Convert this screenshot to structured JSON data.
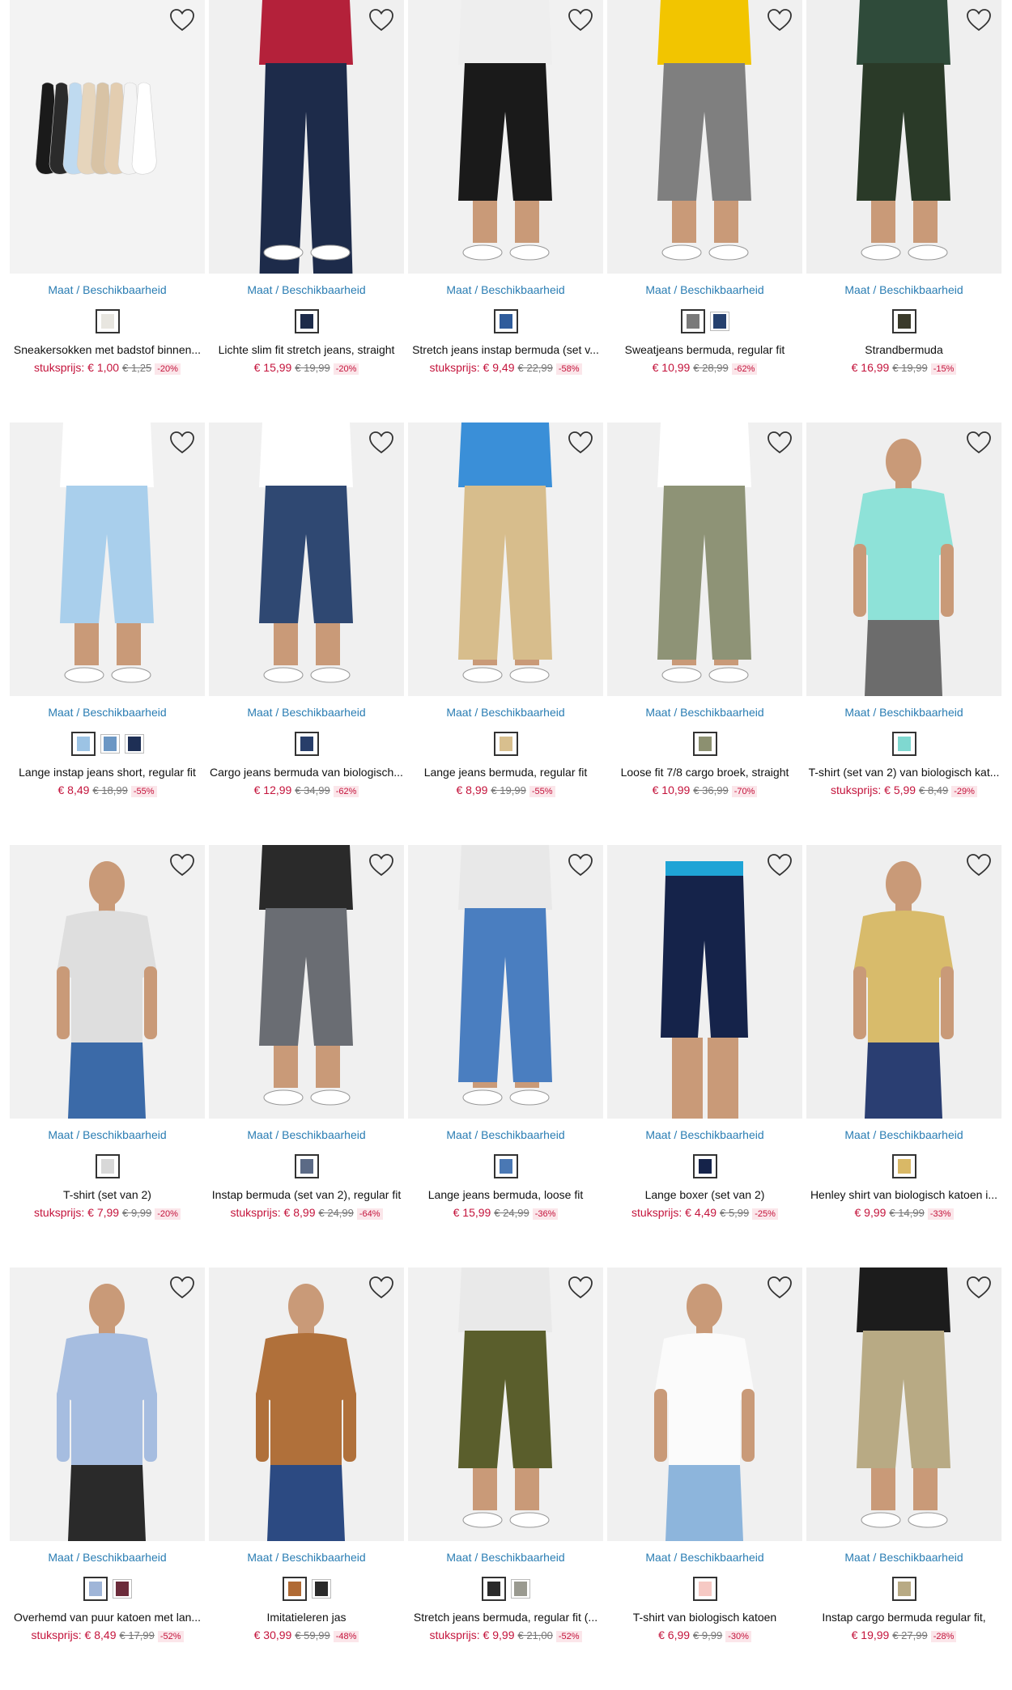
{
  "ui": {
    "size_link": "Maat / Beschikbaarheid"
  },
  "products": [
    {
      "name": "Sneakersokken met badstof binnen...",
      "price": "stuksprijs: € 1,00",
      "old": "€ 1,25",
      "discount": "-20%",
      "bg": "#f3f3f3",
      "swatches": [
        "#e8e6e0"
      ]
    },
    {
      "name": "Lichte slim fit stretch jeans, straight",
      "price": "€ 15,99",
      "old": "€ 19,99",
      "discount": "-20%",
      "bg": "#f0f0f0",
      "swatches": [
        "#1d2b4a"
      ]
    },
    {
      "name": "Stretch jeans instap bermuda (set v...",
      "price": "stuksprijs: € 9,49",
      "old": "€ 22,99",
      "discount": "-58%",
      "bg": "#f1f1f1",
      "swatches": [
        "#2f5c9c"
      ]
    },
    {
      "name": "Sweatjeans bermuda, regular fit",
      "price": "€ 10,99",
      "old": "€ 28,99",
      "discount": "-62%",
      "bg": "#f0f0f0",
      "swatches": [
        "#7a7a7a",
        "#25406e"
      ]
    },
    {
      "name": "Strandbermuda",
      "price": "€ 16,99",
      "old": "€ 19,99",
      "discount": "-15%",
      "bg": "#efefef",
      "swatches": [
        "#3a3a2a"
      ]
    },
    {
      "name": "Lange instap jeans short, regular fit",
      "price": "€ 8,49",
      "old": "€ 18,99",
      "discount": "-55%",
      "bg": "#f1f1f1",
      "swatches": [
        "#9cc3e4",
        "#6c97c4",
        "#1e2f55"
      ]
    },
    {
      "name": "Cargo jeans bermuda van biologisch...",
      "price": "€ 12,99",
      "old": "€ 34,99",
      "discount": "-62%",
      "bg": "#f0f0f0",
      "swatches": [
        "#283e6a"
      ]
    },
    {
      "name": "Lange jeans bermuda, regular fit",
      "price": "€ 8,99",
      "old": "€ 19,99",
      "discount": "-55%",
      "bg": "#f1f1f1",
      "swatches": [
        "#d8bf8e"
      ]
    },
    {
      "name": "Loose fit 7/8 cargo broek, straight",
      "price": "€ 10,99",
      "old": "€ 36,99",
      "discount": "-70%",
      "bg": "#f0f0f0",
      "swatches": [
        "#8c9070"
      ]
    },
    {
      "name": "T-shirt (set van 2) van biologisch kat...",
      "price": "stuksprijs: € 5,99",
      "old": "€ 8,49",
      "discount": "-29%",
      "bg": "#efefef",
      "swatches": [
        "#7fd8d0"
      ]
    },
    {
      "name": "T-shirt (set van 2)",
      "price": "stuksprijs: € 7,99",
      "old": "€ 9,99",
      "discount": "-20%",
      "bg": "#f1f1f1",
      "swatches": [
        "#d8d8d8"
      ]
    },
    {
      "name": "Instap bermuda (set van 2), regular fit",
      "price": "stuksprijs: € 8,99",
      "old": "€ 24,99",
      "discount": "-64%",
      "bg": "#f0f0f0",
      "swatches": [
        "#5b6a86"
      ]
    },
    {
      "name": "Lange jeans bermuda, loose fit",
      "price": "€ 15,99",
      "old": "€ 24,99",
      "discount": "-36%",
      "bg": "#f1f1f1",
      "swatches": [
        "#4a78b4"
      ]
    },
    {
      "name": "Lange boxer (set van 2)",
      "price": "stuksprijs: € 4,49",
      "old": "€ 5,99",
      "discount": "-25%",
      "bg": "#f0f0f0",
      "swatches": [
        "#15234a"
      ]
    },
    {
      "name": "Henley shirt van biologisch katoen i...",
      "price": "€ 9,99",
      "old": "€ 14,99",
      "discount": "-33%",
      "bg": "#efefef",
      "swatches": [
        "#d9b866"
      ]
    },
    {
      "name": "Overhemd van puur katoen met lan...",
      "price": "stuksprijs: € 8,49",
      "old": "€ 17,99",
      "discount": "-52%",
      "bg": "#f1f1f1",
      "swatches": [
        "#9fb5d8",
        "#6b2b3a"
      ]
    },
    {
      "name": "Imitatieleren jas",
      "price": "€ 30,99",
      "old": "€ 59,99",
      "discount": "-48%",
      "bg": "#f0f0f0",
      "swatches": [
        "#b06a34",
        "#2a2a2a"
      ]
    },
    {
      "name": "Stretch jeans bermuda, regular fit (...",
      "price": "stuksprijs: € 9,99",
      "old": "€ 21,00",
      "discount": "-52%",
      "bg": "#f1f1f1",
      "swatches": [
        "#2a2a2a",
        "#9a9a90"
      ]
    },
    {
      "name": "T-shirt van biologisch katoen",
      "price": "€ 6,99",
      "old": "€ 9,99",
      "discount": "-30%",
      "bg": "#f0f0f0",
      "swatches": [
        "#f6c9c4"
      ]
    },
    {
      "name": "Instap cargo bermuda regular fit,",
      "price": "€ 19,99",
      "old": "€ 27,99",
      "discount": "-28%",
      "bg": "#efefef",
      "swatches": [
        "#b8aa84"
      ]
    }
  ]
}
